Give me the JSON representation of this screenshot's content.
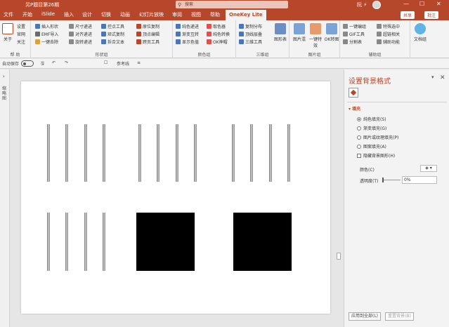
{
  "window": {
    "title": "另P题目第26期",
    "search_placeholder": "搜索",
    "user": "阮 ⚡",
    "minimize": "—",
    "restore": "☐",
    "close": "✕"
  },
  "tabs": [
    "文件",
    "开始",
    "iSlide",
    "插入",
    "设计",
    "切换",
    "动画",
    "幻灯片放映",
    "审阅",
    "视图",
    "帮助",
    "OneKey Lite"
  ],
  "share_label": "共享",
  "comment_label": "批注",
  "ribbon": {
    "groups": {
      "help": "帮 助",
      "shapes": "形状组",
      "colors": "颜色组",
      "three_d": "三维组",
      "images": "图片组",
      "aux": "辅助组"
    },
    "help_items": [
      "关于",
      "设置",
      "官网",
      "关注"
    ],
    "shape_items": [
      "插入形状",
      "EMF导入",
      "一键去除",
      "尺寸递进",
      "对齐递进",
      "旋转递进",
      "控点工具",
      "矩式复制",
      "拆合文本",
      "原位复制",
      "顶点编辑",
      "跨页工具"
    ],
    "color_items": [
      "纯色递进",
      "渐变互转",
      "显示色值",
      "取色器",
      "纯色转换",
      "OK神帽"
    ],
    "three_d_items": [
      "复制分布",
      "顶线层叠",
      "三维工具",
      "图形表"
    ],
    "image_items": [
      "图片混",
      "一键特效",
      "OK转图"
    ],
    "aux_items": [
      "一键编组",
      "GIF工具",
      "分割表",
      "特殊选中",
      "超链相关",
      "辅助功能",
      "文档组"
    ]
  },
  "qat": {
    "autosave": "自动保存",
    "toggle_state": "关",
    "guide": "参考线"
  },
  "left_pane_label": "缩略图",
  "format_pane": {
    "title": "设置背景格式",
    "section": "填充",
    "options": [
      {
        "label": "纯色填充(S)",
        "selected": true
      },
      {
        "label": "渐变填充(G)",
        "selected": false
      },
      {
        "label": "图片或纹理填充(P)",
        "selected": false
      },
      {
        "label": "图案填充(A)",
        "selected": false
      }
    ],
    "hide_bg_label": "隐藏背景图形(H)",
    "color_label": "颜色(C)",
    "transparency_label": "透明度(T)",
    "transparency_value": "0%",
    "apply_all": "应用到全部(L)",
    "reset": "重置背景(B)"
  },
  "colors": {
    "accent": "#b7472a",
    "ribbon_bg": "#f3f3f3",
    "square": "#000000"
  }
}
